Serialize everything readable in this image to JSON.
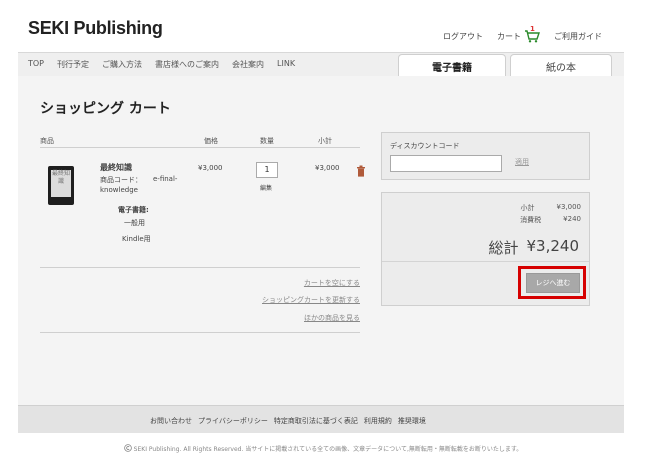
{
  "header": {
    "logo": "SEKI Publishing",
    "logout": "ログアウト",
    "cart": "カート",
    "cart_count": "1",
    "guide": "ご利用ガイド"
  },
  "nav": {
    "items": [
      "TOP",
      "刊行予定",
      "ご購入方法",
      "書店様へのご案内",
      "会社案内",
      "LINK"
    ],
    "tab_ebook": "電子書籍",
    "tab_paper": "紙の本"
  },
  "cart": {
    "title": "ショッピング カート",
    "col_product": "商品",
    "col_price": "価格",
    "col_qty": "数量",
    "col_subtotal": "小計",
    "item": {
      "cover_text": "最終知識",
      "name": "最終知識",
      "code_label": "商品コード：",
      "code_value": "e-final-",
      "code_value2": "knowledge",
      "type_label": "電子書籍:",
      "type_value": "一般用",
      "format": "Kindle用",
      "price": "¥3,000",
      "quantity": "1",
      "edit": "編集",
      "subtotal": "¥3,000"
    },
    "links": {
      "empty": "カートを空にする",
      "update": "ショッピングカートを更新する",
      "continue": "ほかの商品を見る"
    }
  },
  "discount": {
    "label": "ディスカウントコード",
    "input_value": "",
    "apply": "適用"
  },
  "summary": {
    "subtotal_label": "小計",
    "subtotal": "¥3,000",
    "tax_label": "消費税",
    "tax": "¥240",
    "total_label": "総計",
    "total": "¥3,240",
    "checkout": "レジへ進む"
  },
  "footer": {
    "links": [
      "お問い合わせ",
      "プライバシーポリシー",
      "特定商取引法に基づく表記",
      "利用規約",
      "推奨環境"
    ],
    "copyright": "SEKI Publishing. All Rights Reserved.",
    "notice": "当サイトに掲載されている全ての画像、文章データについて,無断転用・無断転載をお断りいたします。"
  },
  "colors": {
    "highlight": "#d60000",
    "checkout_button": "#a8a8a8",
    "background": "#f4f4f4"
  },
  "icons": [
    "cart-icon",
    "trash-icon",
    "copyright-icon"
  ]
}
